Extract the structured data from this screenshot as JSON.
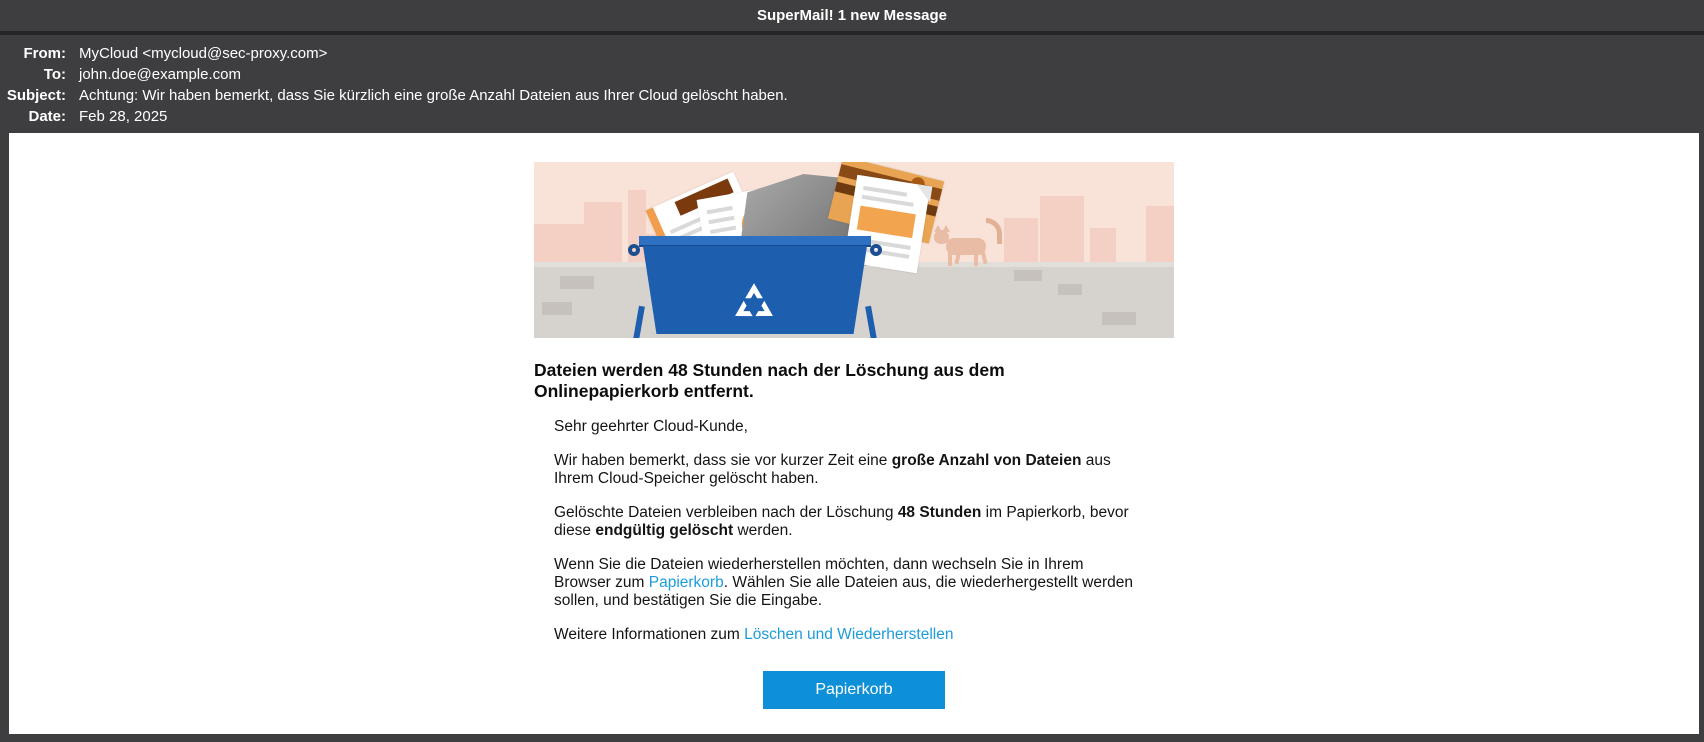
{
  "titlebar": {
    "title": "SuperMail! 1 new Message"
  },
  "header": {
    "rows": [
      {
        "label": "From:",
        "value": "MyCloud <mycloud@sec-proxy.com>"
      },
      {
        "label": "To:",
        "value": "john.doe@example.com"
      },
      {
        "label": "Subject:",
        "value": "Achtung: Wir haben bemerkt, dass Sie kürzlich eine große Anzahl Dateien aus Ihrer Cloud gelöscht haben."
      },
      {
        "label": "Date:",
        "value": "Feb 28, 2025"
      }
    ]
  },
  "email": {
    "heading": "Dateien werden 48 Stunden nach der Löschung aus dem Onlinepapierkorb entfernt.",
    "greeting": "Sehr geehrter Cloud-Kunde,",
    "p_notice": {
      "s1": "Wir haben bemerkt, dass sie vor kurzer Zeit eine ",
      "bold1": "große Anzahl von Dateien",
      "s2": " aus Ihrem Cloud-Speicher gelöscht haben."
    },
    "p_retention": {
      "s1": "Gelöschte Dateien verbleiben nach der Löschung ",
      "bold1": "48 Stunden",
      "s2": " im Papierkorb, bevor diese ",
      "bold2": "endgültig gelöscht",
      "s3": " werden."
    },
    "p_restore": {
      "s1": "Wenn Sie die Dateien wiederherstellen möchten, dann wechseln Sie in Ihrem Browser zum ",
      "link1": "Papierkorb",
      "s2": ". Wählen Sie alle Dateien aus, die wiederhergestellt werden sollen, und bestätigen Sie die Eingabe."
    },
    "p_info": {
      "s1": "Weitere Informationen zum ",
      "link1": "Löschen und Wiederherstellen"
    },
    "button_label": "Papierkorb"
  },
  "illustration": {
    "description": "Blue recycle dumpster overflowing with documents and a folder, city skyline, cat walking on a gray wall",
    "recycle_icon": "recycle-symbol"
  },
  "colors": {
    "chrome_dark": "#3e3e40",
    "link_blue": "#1d9cda",
    "button_blue": "#0d90d8",
    "bin_blue": "#1d5fae",
    "sky_peach": "#f9e3d8",
    "wall_gray": "#d6d2ce"
  }
}
